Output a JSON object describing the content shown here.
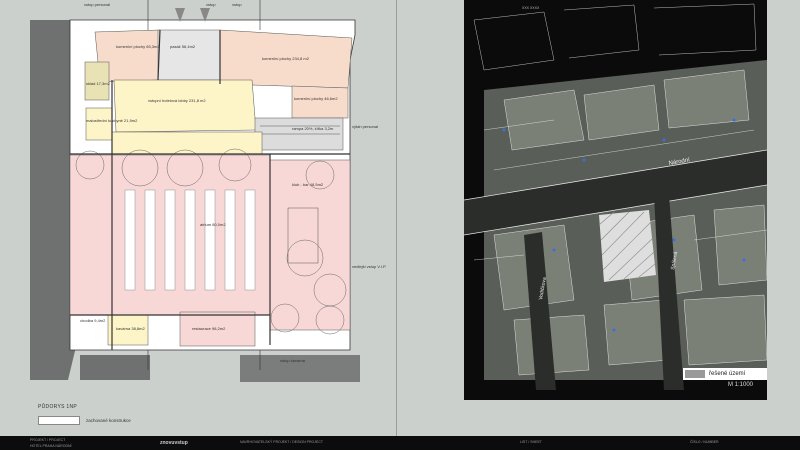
{
  "plan": {
    "title": "PŮDORYS 1NP",
    "legend_label": "zachované konstrukce",
    "top_labels": [
      "vstup personál",
      "vstup",
      "vstup"
    ],
    "rooms": [
      {
        "id": "r1",
        "label": "komerční plochy 65,3m2"
      },
      {
        "id": "r2",
        "label": "pasáž 56,4m2"
      },
      {
        "id": "r3",
        "label": "komerční plochy 234,8 m2"
      },
      {
        "id": "r4",
        "label": "sklad 17,3m2"
      },
      {
        "id": "r5",
        "label": "malostřední kuchyně 21,9m2"
      },
      {
        "id": "r6",
        "label": "vstupní hotelová lobby 231,8 m2"
      },
      {
        "id": "r7",
        "label": "komerční plochy 46,6m2"
      },
      {
        "id": "r8",
        "label": "rampa 20%, šířka 3,2m"
      },
      {
        "id": "r9",
        "label": "klub - bar 48,5m2"
      },
      {
        "id": "r10",
        "label": "atrium 80,0m2"
      },
      {
        "id": "r11",
        "label": "restaurace 98,2m2"
      },
      {
        "id": "r12",
        "label": "kavárna 38,8m2"
      },
      {
        "id": "r13",
        "label": "chodba 9,4m2"
      }
    ],
    "side_labels": [
      {
        "id": "s1",
        "label": "výtah personal"
      },
      {
        "id": "s2",
        "label": "vedlejší vstup V.I.P."
      },
      {
        "id": "s3",
        "label": "vstup kavárna"
      }
    ]
  },
  "map": {
    "street_label": "Národní",
    "street_label_2": "Vodičkova",
    "street_label_3": "Spálená",
    "area_label": "řešené území",
    "scale": "M 1:1000",
    "top_text": "XXX XXXX"
  },
  "footer": {
    "left_1": "PROJEKT / PROJECT",
    "left_2": "HOTEL PRAHA NÁRODNÍ",
    "brand": "znovuvstup",
    "center": "NAVRHOVATELSKÝ PROJEKT / DESIGN PROJECT",
    "right_1": "LIST / SHEET",
    "right_2": "ČÍSLO / NUMBER"
  }
}
